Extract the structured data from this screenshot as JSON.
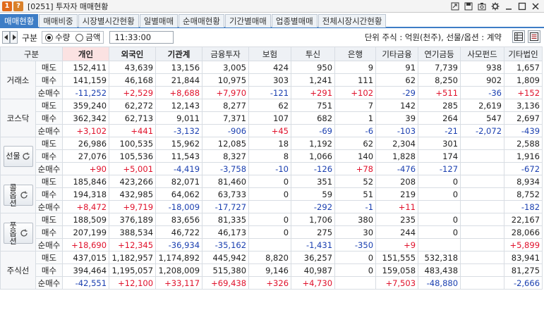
{
  "window": {
    "badge_one": "1",
    "badge_q": "?",
    "title": "[0251] 투자자 매매현황",
    "buttons": [
      "link-icon",
      "save-icon",
      "capture-icon",
      "settings-icon",
      "minimize-icon",
      "maximize-icon",
      "close-icon"
    ]
  },
  "tabs": [
    {
      "label": "매매현황",
      "active": true
    },
    {
      "label": "매매비중"
    },
    {
      "label": "시장별시간현황"
    },
    {
      "label": "일별매매"
    },
    {
      "label": "순매매현황"
    },
    {
      "label": "기간별매매"
    },
    {
      "label": "업종별매매"
    },
    {
      "label": "전체시장시간현황"
    }
  ],
  "controls": {
    "category_label": "구분",
    "radio_qty": "수량",
    "radio_amount": "금액",
    "time": "11:33:00",
    "unit": "단위 주식 : 억원(천주), 선물/옵션 : 계약"
  },
  "table": {
    "headers": [
      "구분",
      "",
      "개인",
      "외국인",
      "기관계",
      "금융투자",
      "보험",
      "투신",
      "은행",
      "기타금융",
      "연기금등",
      "사모펀드",
      "기타법인"
    ],
    "groups": [
      {
        "name": "거래소",
        "button": false,
        "rows": [
          {
            "label": "매도",
            "values": [
              "152,411",
              "43,639",
              "13,156",
              "3,005",
              "424",
              "950",
              "9",
              "91",
              "7,739",
              "938",
              "1,657"
            ]
          },
          {
            "label": "매수",
            "values": [
              "141,159",
              "46,168",
              "21,844",
              "10,975",
              "303",
              "1,241",
              "111",
              "62",
              "8,250",
              "902",
              "1,809"
            ]
          },
          {
            "label": "순매수",
            "values": [
              "-11,252",
              "+2,529",
              "+8,688",
              "+7,970",
              "-121",
              "+291",
              "+102",
              "-29",
              "+511",
              "-36",
              "+152"
            ]
          }
        ]
      },
      {
        "name": "코스닥",
        "button": false,
        "rows": [
          {
            "label": "매도",
            "values": [
              "359,240",
              "62,272",
              "12,143",
              "8,277",
              "62",
              "751",
              "7",
              "142",
              "285",
              "2,619",
              "3,136"
            ]
          },
          {
            "label": "매수",
            "values": [
              "362,342",
              "62,713",
              "9,011",
              "7,371",
              "107",
              "682",
              "1",
              "39",
              "264",
              "547",
              "2,697"
            ]
          },
          {
            "label": "순매수",
            "values": [
              "+3,102",
              "+441",
              "-3,132",
              "-906",
              "+45",
              "-69",
              "-6",
              "-103",
              "-21",
              "-2,072",
              "-439"
            ]
          }
        ]
      },
      {
        "name": "선물",
        "button": true,
        "rows": [
          {
            "label": "매도",
            "values": [
              "26,986",
              "100,535",
              "15,962",
              "12,085",
              "18",
              "1,192",
              "62",
              "2,304",
              "301",
              "",
              "2,588"
            ]
          },
          {
            "label": "매수",
            "values": [
              "27,076",
              "105,536",
              "11,543",
              "8,327",
              "8",
              "1,066",
              "140",
              "1,828",
              "174",
              "",
              "1,916"
            ]
          },
          {
            "label": "순매수",
            "values": [
              "+90",
              "+5,001",
              "-4,419",
              "-3,758",
              "-10",
              "-126",
              "+78",
              "-476",
              "-127",
              "",
              "-672"
            ]
          }
        ]
      },
      {
        "name": "콜옵션",
        "button": true,
        "rows": [
          {
            "label": "매도",
            "values": [
              "185,846",
              "423,266",
              "82,071",
              "81,460",
              "0",
              "351",
              "52",
              "208",
              "0",
              "",
              "8,934"
            ]
          },
          {
            "label": "매수",
            "values": [
              "194,318",
              "432,985",
              "64,062",
              "63,733",
              "0",
              "59",
              "51",
              "219",
              "0",
              "",
              "8,752"
            ]
          },
          {
            "label": "순매수",
            "values": [
              "+8,472",
              "+9,719",
              "-18,009",
              "-17,727",
              "",
              "-292",
              "-1",
              "+11",
              "",
              "",
              "-182"
            ]
          }
        ]
      },
      {
        "name": "풋옵션",
        "button": true,
        "rows": [
          {
            "label": "매도",
            "values": [
              "188,509",
              "376,189",
              "83,656",
              "81,335",
              "0",
              "1,706",
              "380",
              "235",
              "0",
              "",
              "22,167"
            ]
          },
          {
            "label": "매수",
            "values": [
              "207,199",
              "388,534",
              "46,722",
              "46,173",
              "0",
              "275",
              "30",
              "244",
              "0",
              "",
              "28,066"
            ]
          },
          {
            "label": "순매수",
            "values": [
              "+18,690",
              "+12,345",
              "-36,934",
              "-35,162",
              "",
              "-1,431",
              "-350",
              "+9",
              "",
              "",
              "+5,899"
            ]
          }
        ]
      },
      {
        "name": "주식선",
        "button": false,
        "rows": [
          {
            "label": "매도",
            "values": [
              "437,015",
              "1,182,957",
              "1,174,892",
              "445,942",
              "8,820",
              "36,257",
              "0",
              "151,555",
              "532,318",
              "",
              "83,941"
            ]
          },
          {
            "label": "매수",
            "values": [
              "394,464",
              "1,195,057",
              "1,208,009",
              "515,380",
              "9,146",
              "40,987",
              "0",
              "159,058",
              "483,438",
              "",
              "81,275"
            ]
          },
          {
            "label": "순매수",
            "values": [
              "-42,551",
              "+12,100",
              "+33,117",
              "+69,438",
              "+326",
              "+4,730",
              "",
              "+7,503",
              "-48,880",
              "",
              "-2,666"
            ]
          }
        ]
      }
    ]
  },
  "colors": {
    "positive": "#e0112b",
    "negative": "#1a3fb0",
    "tab_active": "#3d7dc6",
    "highlight_header": "#fbe2e2"
  }
}
